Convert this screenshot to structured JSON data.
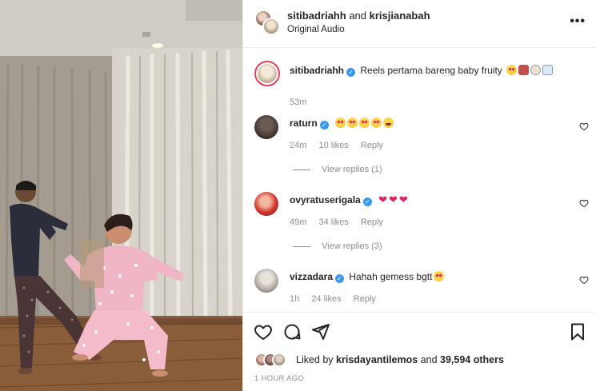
{
  "header": {
    "user1": "sitibadriahh",
    "joiner": "and",
    "user2": "krisjianabah",
    "audio": "Original Audio",
    "more_label": "•••"
  },
  "caption": {
    "user": "sitibadriahh",
    "text": "Reels pertama bareng baby fruity",
    "time": "53m"
  },
  "comments": [
    {
      "user": "raturn",
      "text": "",
      "emojis": [
        "star",
        "star",
        "star",
        "star",
        "lol"
      ],
      "time": "24m",
      "likes": "10 likes",
      "reply": "Reply",
      "view_replies": "View replies (1)"
    },
    {
      "user": "ovyratuserigala",
      "text": "",
      "emojis": [
        "heart",
        "heart",
        "heart"
      ],
      "time": "49m",
      "likes": "34 likes",
      "reply": "Reply",
      "view_replies": "View replies (3)"
    },
    {
      "user": "vizzadara",
      "text": "Hahah gemess bgtt",
      "emojis": [
        "star"
      ],
      "time": "1h",
      "likes": "24 likes",
      "reply": "Reply"
    }
  ],
  "actions": {
    "like_icon": "heart-icon",
    "comment_icon": "comment-icon",
    "share_icon": "share-icon",
    "save_icon": "bookmark-icon"
  },
  "likes": {
    "prefix": "Liked by",
    "user": "krisdayantilemos",
    "joiner": "and",
    "others": "39,594 others"
  },
  "timestamp": "1 HOUR AGO",
  "colors": {
    "verified": "#3897f0",
    "meta_gray": "#8e8e8e",
    "heart_red": "#e0245e"
  }
}
